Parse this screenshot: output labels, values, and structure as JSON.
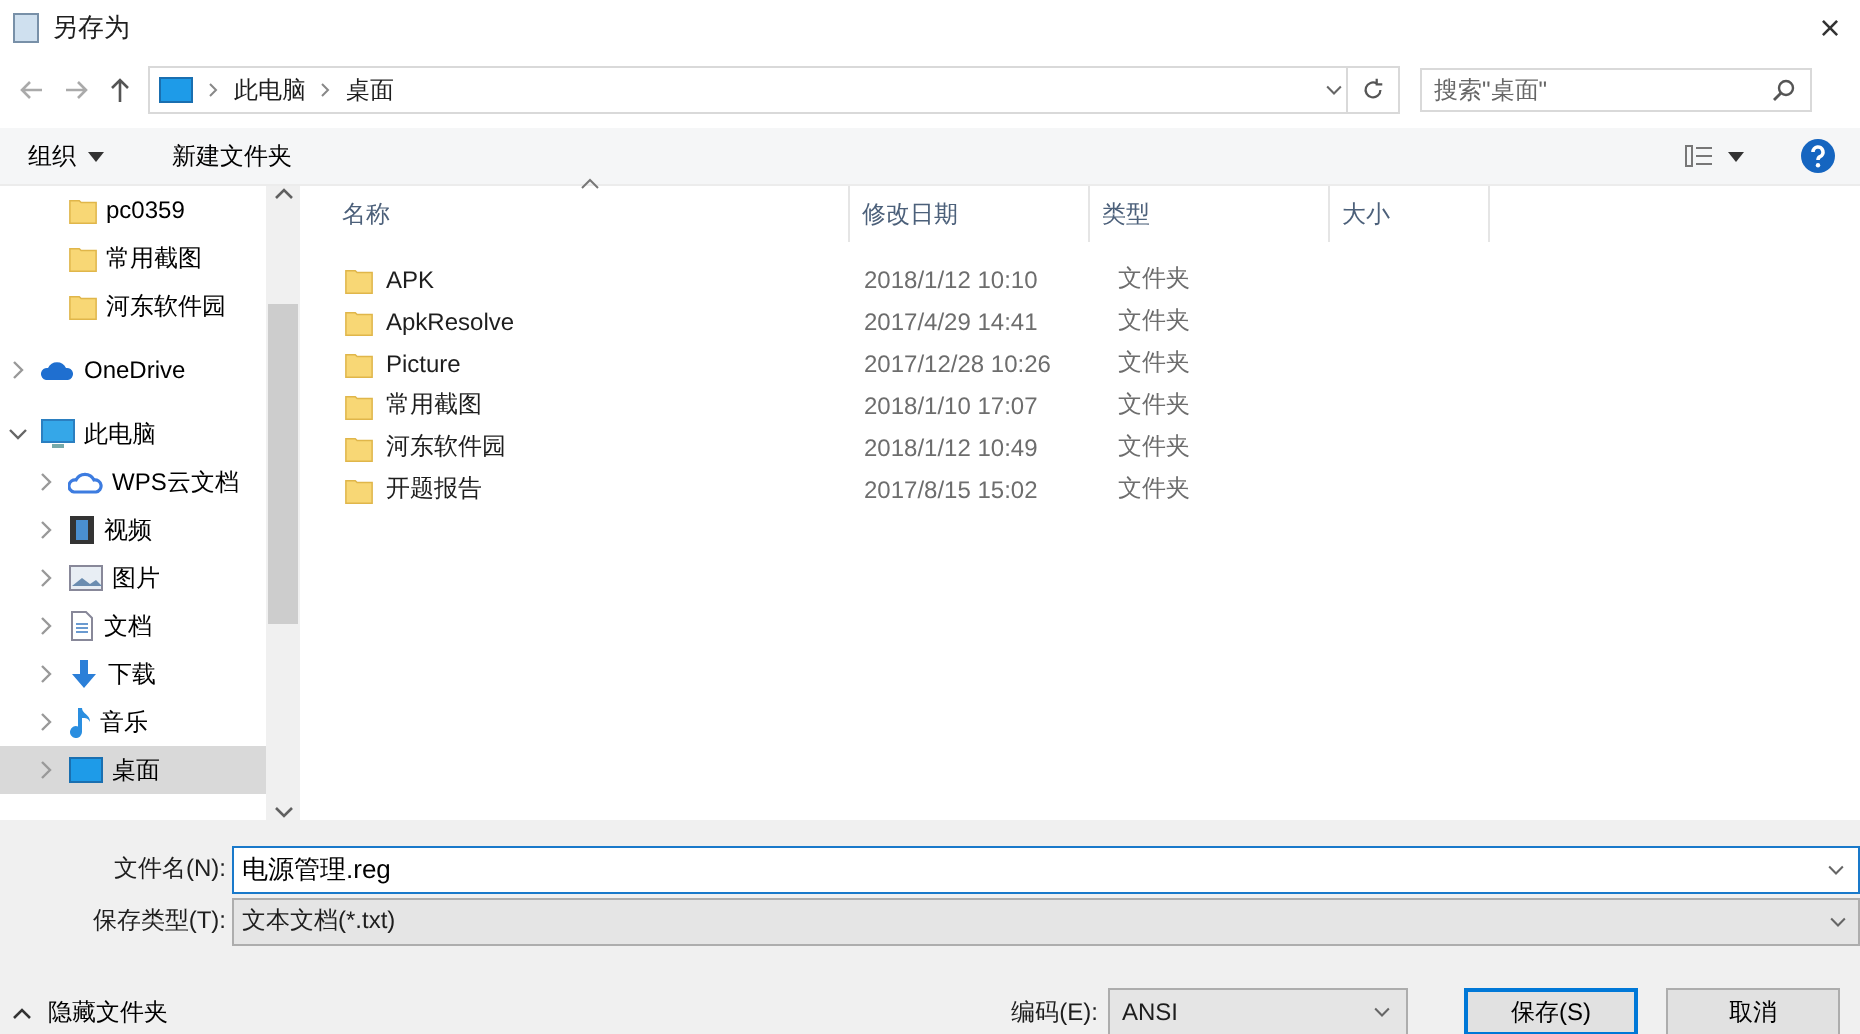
{
  "window": {
    "title": "另存为",
    "close": "×"
  },
  "address": {
    "path": [
      "此电脑",
      "桌面"
    ],
    "search_placeholder": "搜索\"桌面\""
  },
  "toolbar": {
    "organize": "组织",
    "new_folder": "新建文件夹"
  },
  "sidebar": {
    "quick_access_children": [
      {
        "label": "pc0359",
        "kind": "folder",
        "selected": false
      },
      {
        "label": "常用截图",
        "kind": "folder",
        "selected": false
      },
      {
        "label": "河东软件园",
        "kind": "folder",
        "selected": false
      }
    ],
    "items": [
      {
        "label": "OneDrive",
        "kind": "cloud",
        "expanded": false,
        "selected": false
      },
      {
        "label": "此电脑",
        "kind": "pc",
        "expanded": true,
        "selected": false,
        "children": [
          {
            "label": "WPS云文档",
            "kind": "wps",
            "expanded": false,
            "selected": false
          },
          {
            "label": "视频",
            "kind": "video",
            "expanded": false,
            "selected": false
          },
          {
            "label": "图片",
            "kind": "image",
            "expanded": false,
            "selected": false
          },
          {
            "label": "文档",
            "kind": "document",
            "expanded": false,
            "selected": false
          },
          {
            "label": "下载",
            "kind": "download",
            "expanded": false,
            "selected": false
          },
          {
            "label": "音乐",
            "kind": "music",
            "expanded": false,
            "selected": false
          },
          {
            "label": "桌面",
            "kind": "desktop",
            "expanded": false,
            "selected": true
          }
        ]
      }
    ]
  },
  "table": {
    "columns": [
      "名称",
      "修改日期",
      "类型",
      "大小"
    ],
    "rows": [
      {
        "name": "APK",
        "modified": "2018/1/12 10:10",
        "type": "文件夹"
      },
      {
        "name": "ApkResolve",
        "modified": "2017/4/29 14:41",
        "type": "文件夹"
      },
      {
        "name": "Picture",
        "modified": "2017/12/28 10:26",
        "type": "文件夹"
      },
      {
        "name": "常用截图",
        "modified": "2018/1/10 17:07",
        "type": "文件夹"
      },
      {
        "name": "河东软件园",
        "modified": "2018/1/12 10:49",
        "type": "文件夹"
      },
      {
        "name": "开题报告",
        "modified": "2017/8/15 15:02",
        "type": "文件夹"
      }
    ]
  },
  "form": {
    "file_name_label": "文件名(N):",
    "file_name": "电源管理.reg",
    "file_type_label": "保存类型(T):",
    "file_type": "文本文档(*.txt)"
  },
  "footer": {
    "hide_folders": "隐藏文件夹",
    "encoding_label": "编码(E):",
    "encoding": "ANSI",
    "save": "保存(S)",
    "cancel": "取消"
  }
}
